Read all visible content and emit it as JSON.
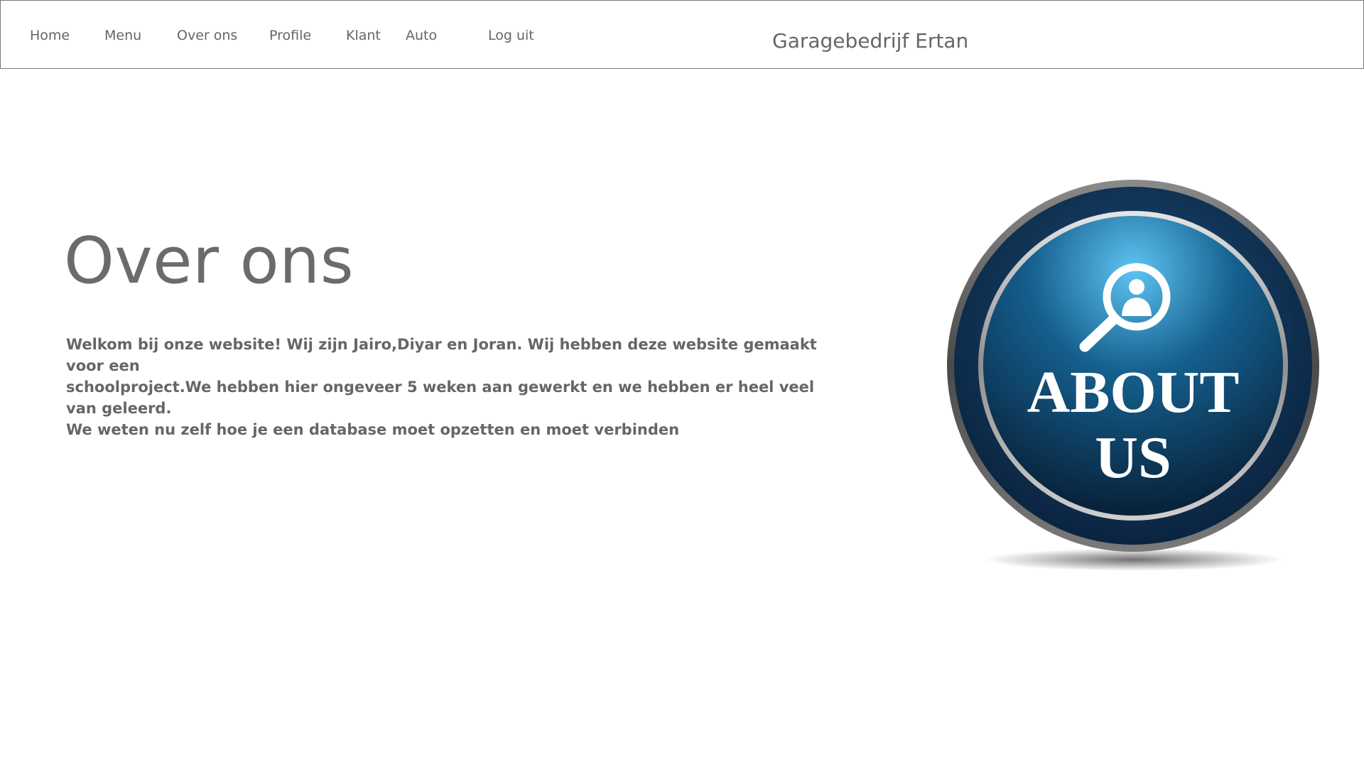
{
  "nav": {
    "items": [
      {
        "label": "Home"
      },
      {
        "label": "Menu"
      },
      {
        "label": "Over ons"
      },
      {
        "label": "Profile"
      },
      {
        "label": "Klant"
      },
      {
        "label": "Auto"
      },
      {
        "label": "Log uit"
      }
    ],
    "brand": "Garagebedrijf Ertan"
  },
  "main": {
    "title": "Over ons",
    "intro_lines": [
      "Welkom bij onze website! Wij zijn Jairo,Diyar en Joran. Wij hebben deze website gemaakt voor een",
      "schoolproject.We hebben hier ongeveer 5 weken aan gewerkt en we hebben er heel veel van geleerd.",
      "We weten nu zelf hoe je een database moet opzetten en moet verbinden"
    ]
  },
  "badge": {
    "line1": "ABOUT",
    "line2": "US",
    "icon": "magnifier-person-icon",
    "colors": {
      "ring_outer": "#5a5a5a",
      "ring_inner": "#b8b8b8",
      "disc_light": "#5ec4f2",
      "disc_mid": "#15608f",
      "disc_dark": "#071d33",
      "text": "#ffffff"
    }
  }
}
